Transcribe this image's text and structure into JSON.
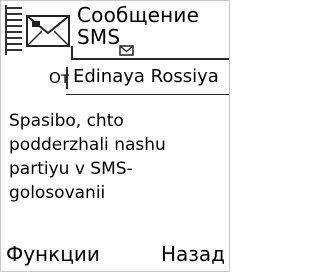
{
  "header": {
    "title_line1": "Сообщение",
    "title_line2": "SMS"
  },
  "message_meta": {
    "from_label": "От",
    "from_value": "Edinaya Rossiya"
  },
  "message": {
    "body": "Spasibo, chto podderzhali nashu partiyu v SMS-golosovanii"
  },
  "softkeys": {
    "left_label": "Функции",
    "right_label": "Назад"
  },
  "icons": {
    "left_strip": "signal-strength-icon",
    "message": "envelope-icon",
    "small_message": "small-envelope-icon"
  }
}
